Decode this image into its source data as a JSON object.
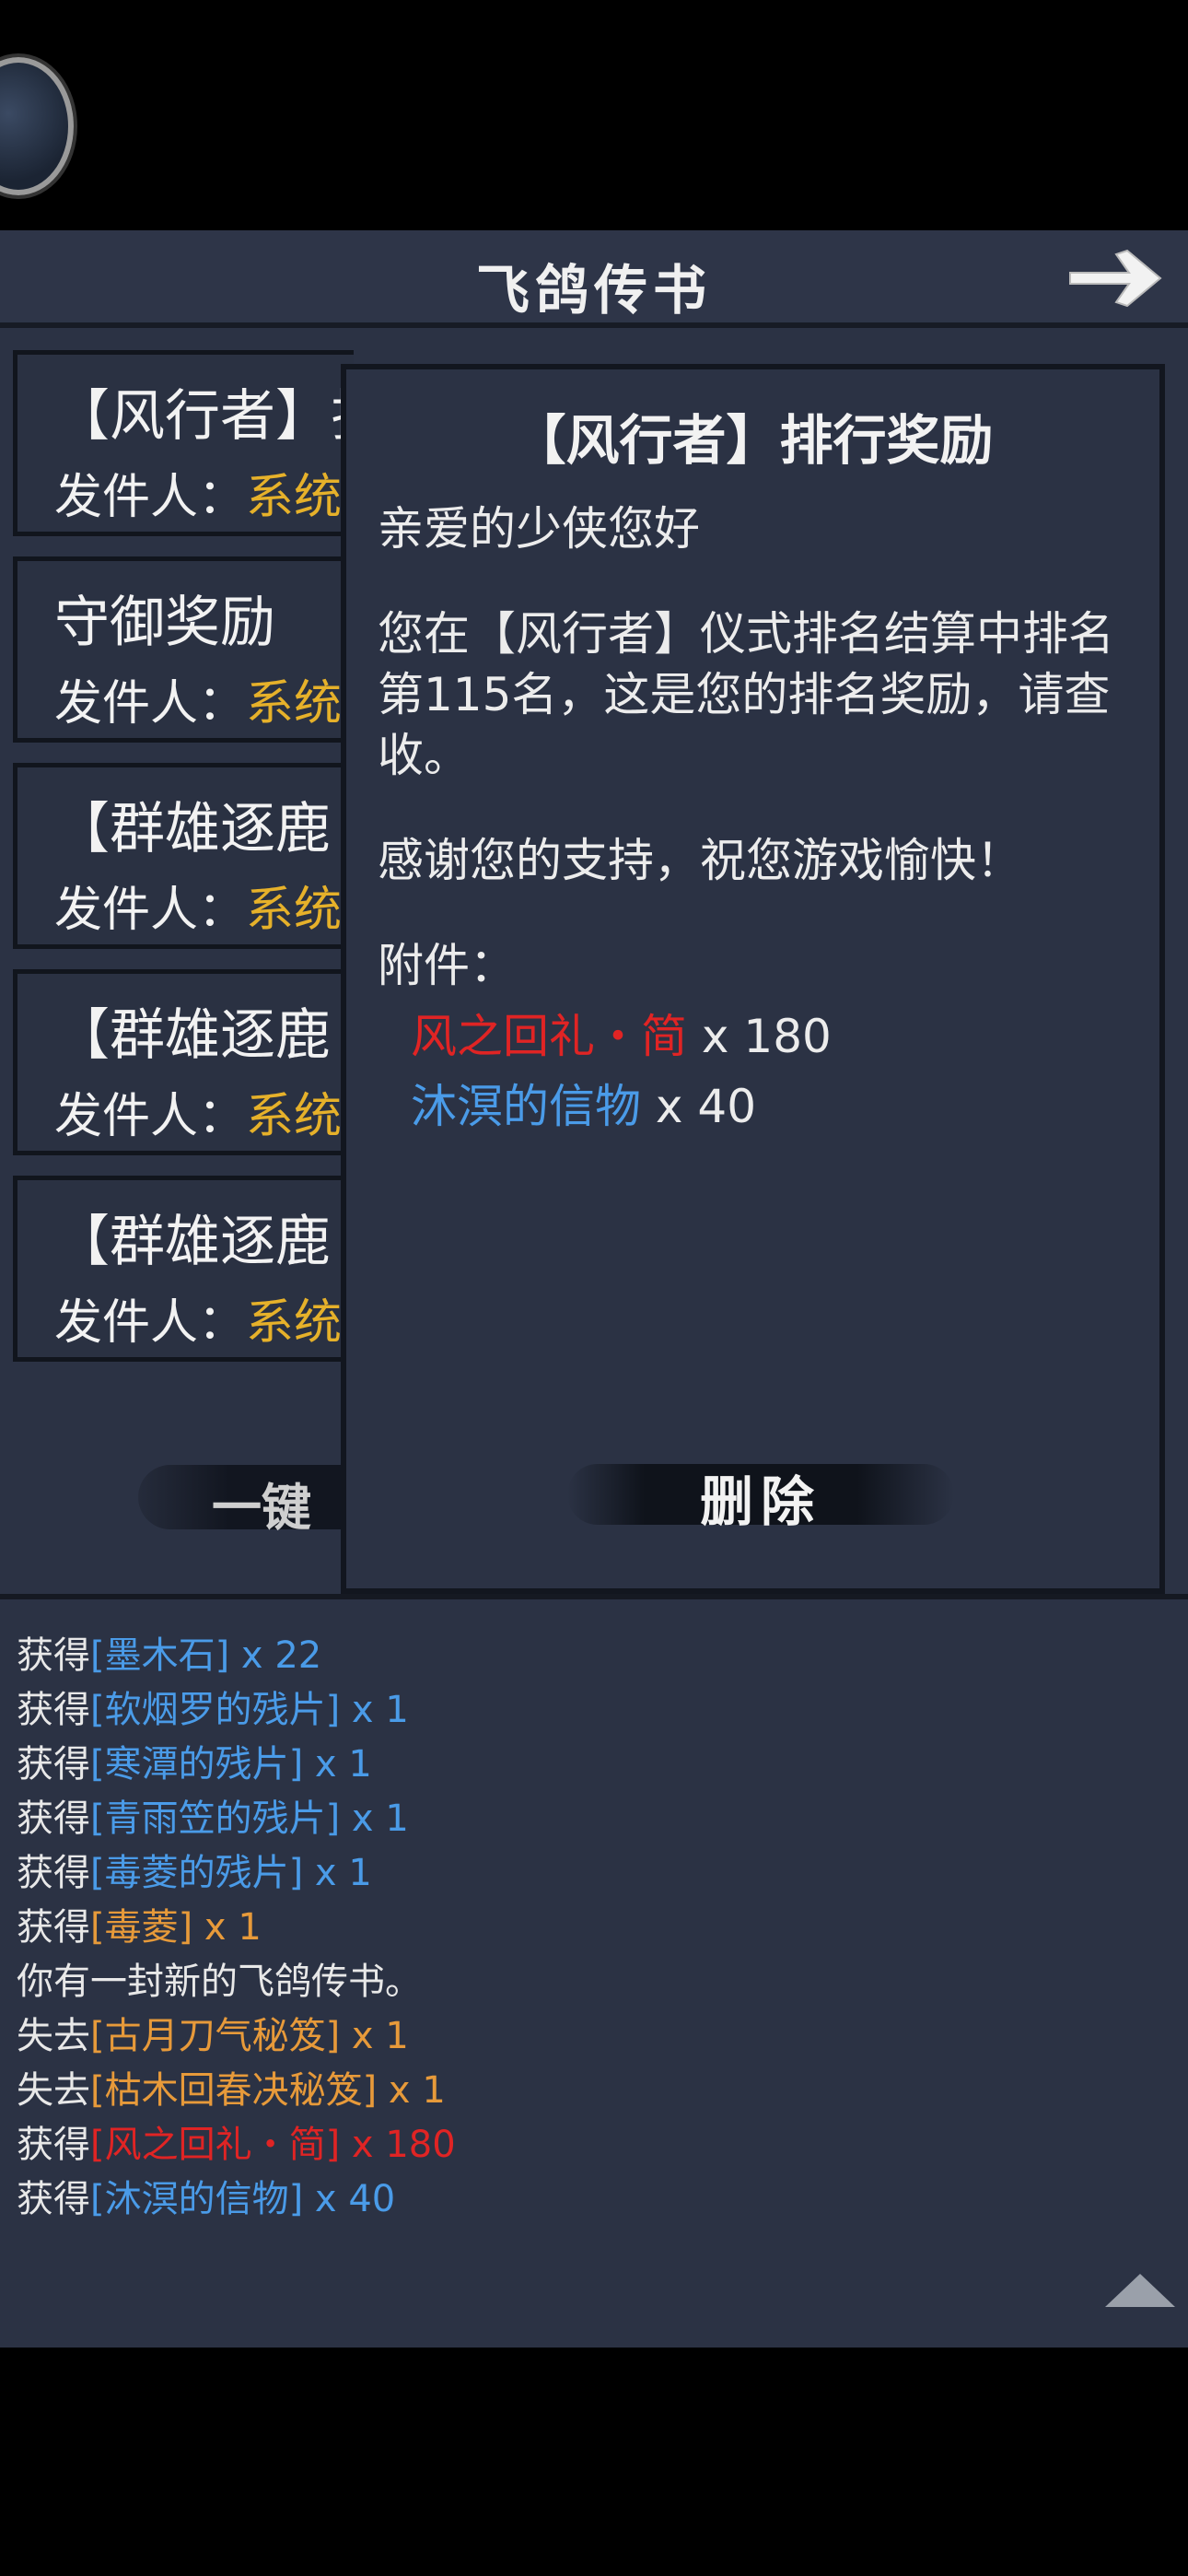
{
  "header": {
    "title": "飞鸽传书"
  },
  "mail_list": [
    {
      "title": "【风行者】排",
      "sender_label": "发件人：",
      "sender": "系统"
    },
    {
      "title": "守御奖励",
      "sender_label": "发件人：",
      "sender": "系统"
    },
    {
      "title": "【群雄逐鹿",
      "sender_label": "发件人：",
      "sender": "系统"
    },
    {
      "title": "【群雄逐鹿",
      "sender_label": "发件人：",
      "sender": "系统"
    },
    {
      "title": "【群雄逐鹿",
      "sender_label": "发件人：",
      "sender": "系统"
    }
  ],
  "bulk_button": {
    "label": "一键"
  },
  "detail": {
    "title": "【风行者】排行奖励",
    "greeting": "亲爱的少侠您好",
    "body": "您在【风行者】仪式排名结算中排名第115名，这是您的排名奖励，请查收。",
    "thanks": "感谢您的支持，祝您游戏愉快！",
    "attachment_label": "附件：",
    "attachments": [
      {
        "name": "风之回礼・简",
        "qty": " x 180",
        "color": "#e02424"
      },
      {
        "name": "沐溟的信物",
        "qty": " x 40",
        "color": "#4a9be8"
      }
    ],
    "delete_label": "删除"
  },
  "log": [
    {
      "prefix": "获得",
      "item": "[墨木石]",
      "qty": " x 22",
      "color": "#4a9be8"
    },
    {
      "prefix": "获得",
      "item": "[软烟罗的残片]",
      "qty": " x 1",
      "color": "#4a9be8"
    },
    {
      "prefix": "获得",
      "item": "[寒潭的残片]",
      "qty": " x 1",
      "color": "#4a9be8"
    },
    {
      "prefix": "获得",
      "item": "[青雨笠的残片]",
      "qty": " x 1",
      "color": "#4a9be8"
    },
    {
      "prefix": "获得",
      "item": "[毒菱的残片]",
      "qty": " x 1",
      "color": "#4a9be8"
    },
    {
      "prefix": "获得",
      "item": "[毒菱]",
      "qty": " x 1",
      "color": "#e79a3a"
    },
    {
      "prefix": "你有一封新的飞鸽传书。",
      "item": "",
      "qty": "",
      "color": "#e8e8e8"
    },
    {
      "prefix": "失去",
      "item": "[古月刀气秘笈]",
      "qty": " x 1",
      "color": "#e79a3a"
    },
    {
      "prefix": "失去",
      "item": "[枯木回春决秘笈]",
      "qty": " x 1",
      "color": "#e79a3a"
    },
    {
      "prefix": "获得",
      "item": "[风之回礼・简]",
      "qty": " x 180",
      "color": "#e02424"
    },
    {
      "prefix": "获得",
      "item": "[沐溟的信物]",
      "qty": " x 40",
      "color": "#4a9be8"
    }
  ]
}
